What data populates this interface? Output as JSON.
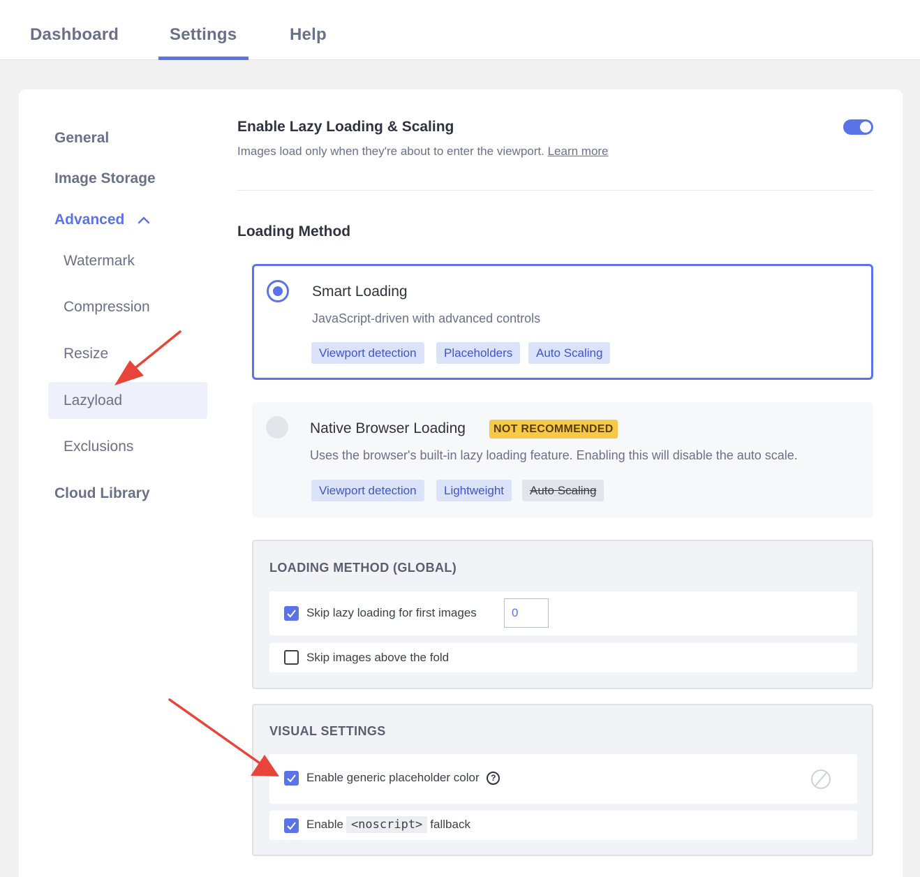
{
  "top_tabs": [
    {
      "label": "Dashboard",
      "active": false
    },
    {
      "label": "Settings",
      "active": true
    },
    {
      "label": "Help",
      "active": false
    }
  ],
  "sidebar": {
    "items": [
      "General",
      "Image Storage",
      "Advanced",
      "Cloud Library"
    ],
    "advanced_expanded": true,
    "sub_items": [
      "Watermark",
      "Compression",
      "Resize",
      "Lazyload",
      "Exclusions"
    ],
    "active_sub_item": "Lazyload"
  },
  "main": {
    "enable_title": "Enable Lazy Loading & Scaling",
    "enable_desc": "Images load only when they're about to enter the viewport.",
    "learn_more": "Learn more",
    "enabled": true,
    "loading_method_title": "Loading Method",
    "options": [
      {
        "title": "Smart Loading",
        "desc": "JavaScript-driven with advanced controls",
        "selected": true,
        "chips": [
          "Viewport detection",
          "Placeholders",
          "Auto Scaling"
        ]
      },
      {
        "title": "Native Browser Loading",
        "badge": "NOT RECOMMENDED",
        "desc": "Uses the browser's built-in lazy loading feature. Enabling this will disable the auto scale.",
        "selected": false,
        "chips": [
          "Viewport detection",
          "Lightweight",
          "Auto Scaling"
        ]
      }
    ],
    "global_panel": {
      "title": "LOADING METHOD (GLOBAL)",
      "skip_first_label": "Skip lazy loading for first images",
      "skip_first_checked": true,
      "skip_first_value": "0",
      "skip_fold_label": "Skip images above the fold",
      "skip_fold_checked": false
    },
    "visual_panel": {
      "title": "VISUAL SETTINGS",
      "placeholder_label": "Enable generic placeholder color",
      "placeholder_checked": true,
      "help_glyph": "?",
      "noscript_prefix": "Enable",
      "noscript_code": "<noscript>",
      "noscript_suffix": "fallback",
      "noscript_checked": true
    }
  },
  "colors": {
    "accent": "#5b73e8",
    "warning_badge": "#f7c948",
    "annotation_arrow": "#e8443a"
  }
}
